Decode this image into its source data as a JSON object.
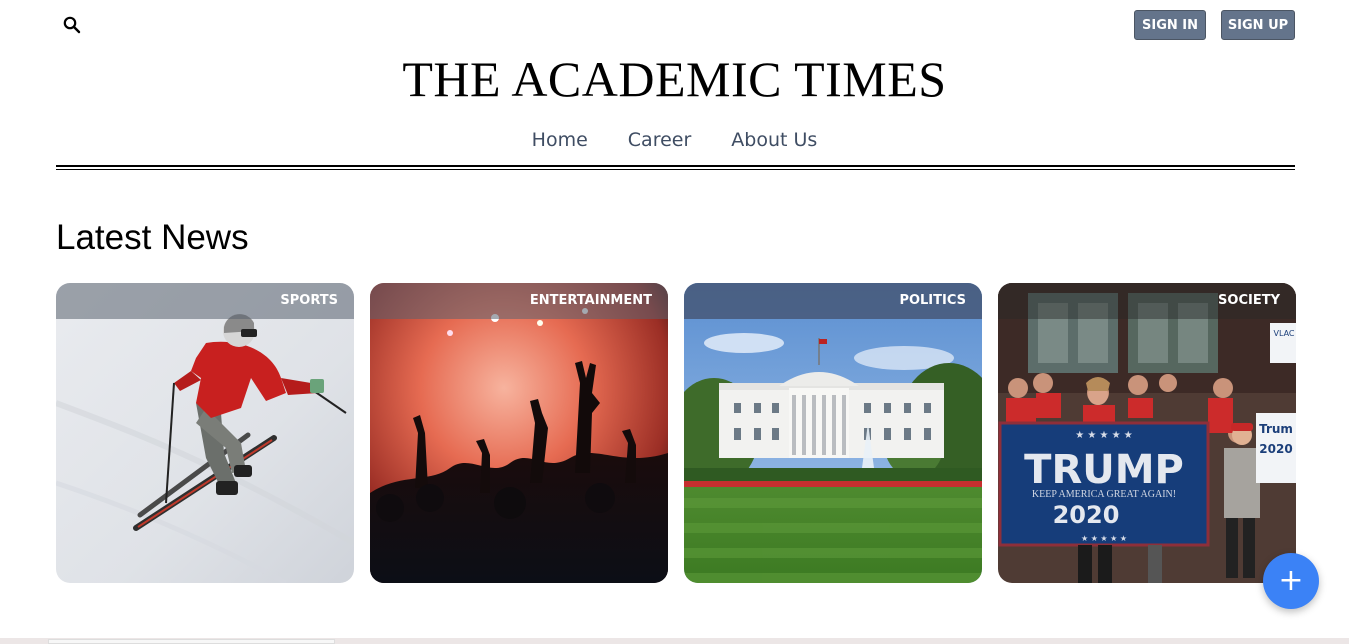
{
  "header": {
    "search_icon": "search-icon",
    "sign_in_label": "SIGN IN",
    "sign_up_label": "SIGN UP",
    "site_title": "THE ACADEMIC TIMES"
  },
  "nav": {
    "items": [
      {
        "label": "Home"
      },
      {
        "label": "Career"
      },
      {
        "label": "About Us"
      }
    ]
  },
  "main": {
    "section_title": "Latest News",
    "cards": [
      {
        "category": "SPORTS"
      },
      {
        "category": "ENTERTAINMENT"
      },
      {
        "category": "POLITICS"
      },
      {
        "category": "SOCIETY"
      }
    ],
    "society_image_text": {
      "banner_main": "TRUMP",
      "banner_sub": "KEEP AMERICA GREAT AGAIN!",
      "banner_year": "2020",
      "sign_small": "Trum",
      "sign_small_year": "2020",
      "sign_top": "VLAC"
    }
  },
  "fab": {
    "label": "+"
  },
  "colors": {
    "auth_button": "#64748b",
    "nav_text": "#3f4d63",
    "fab": "#3b82f6"
  }
}
